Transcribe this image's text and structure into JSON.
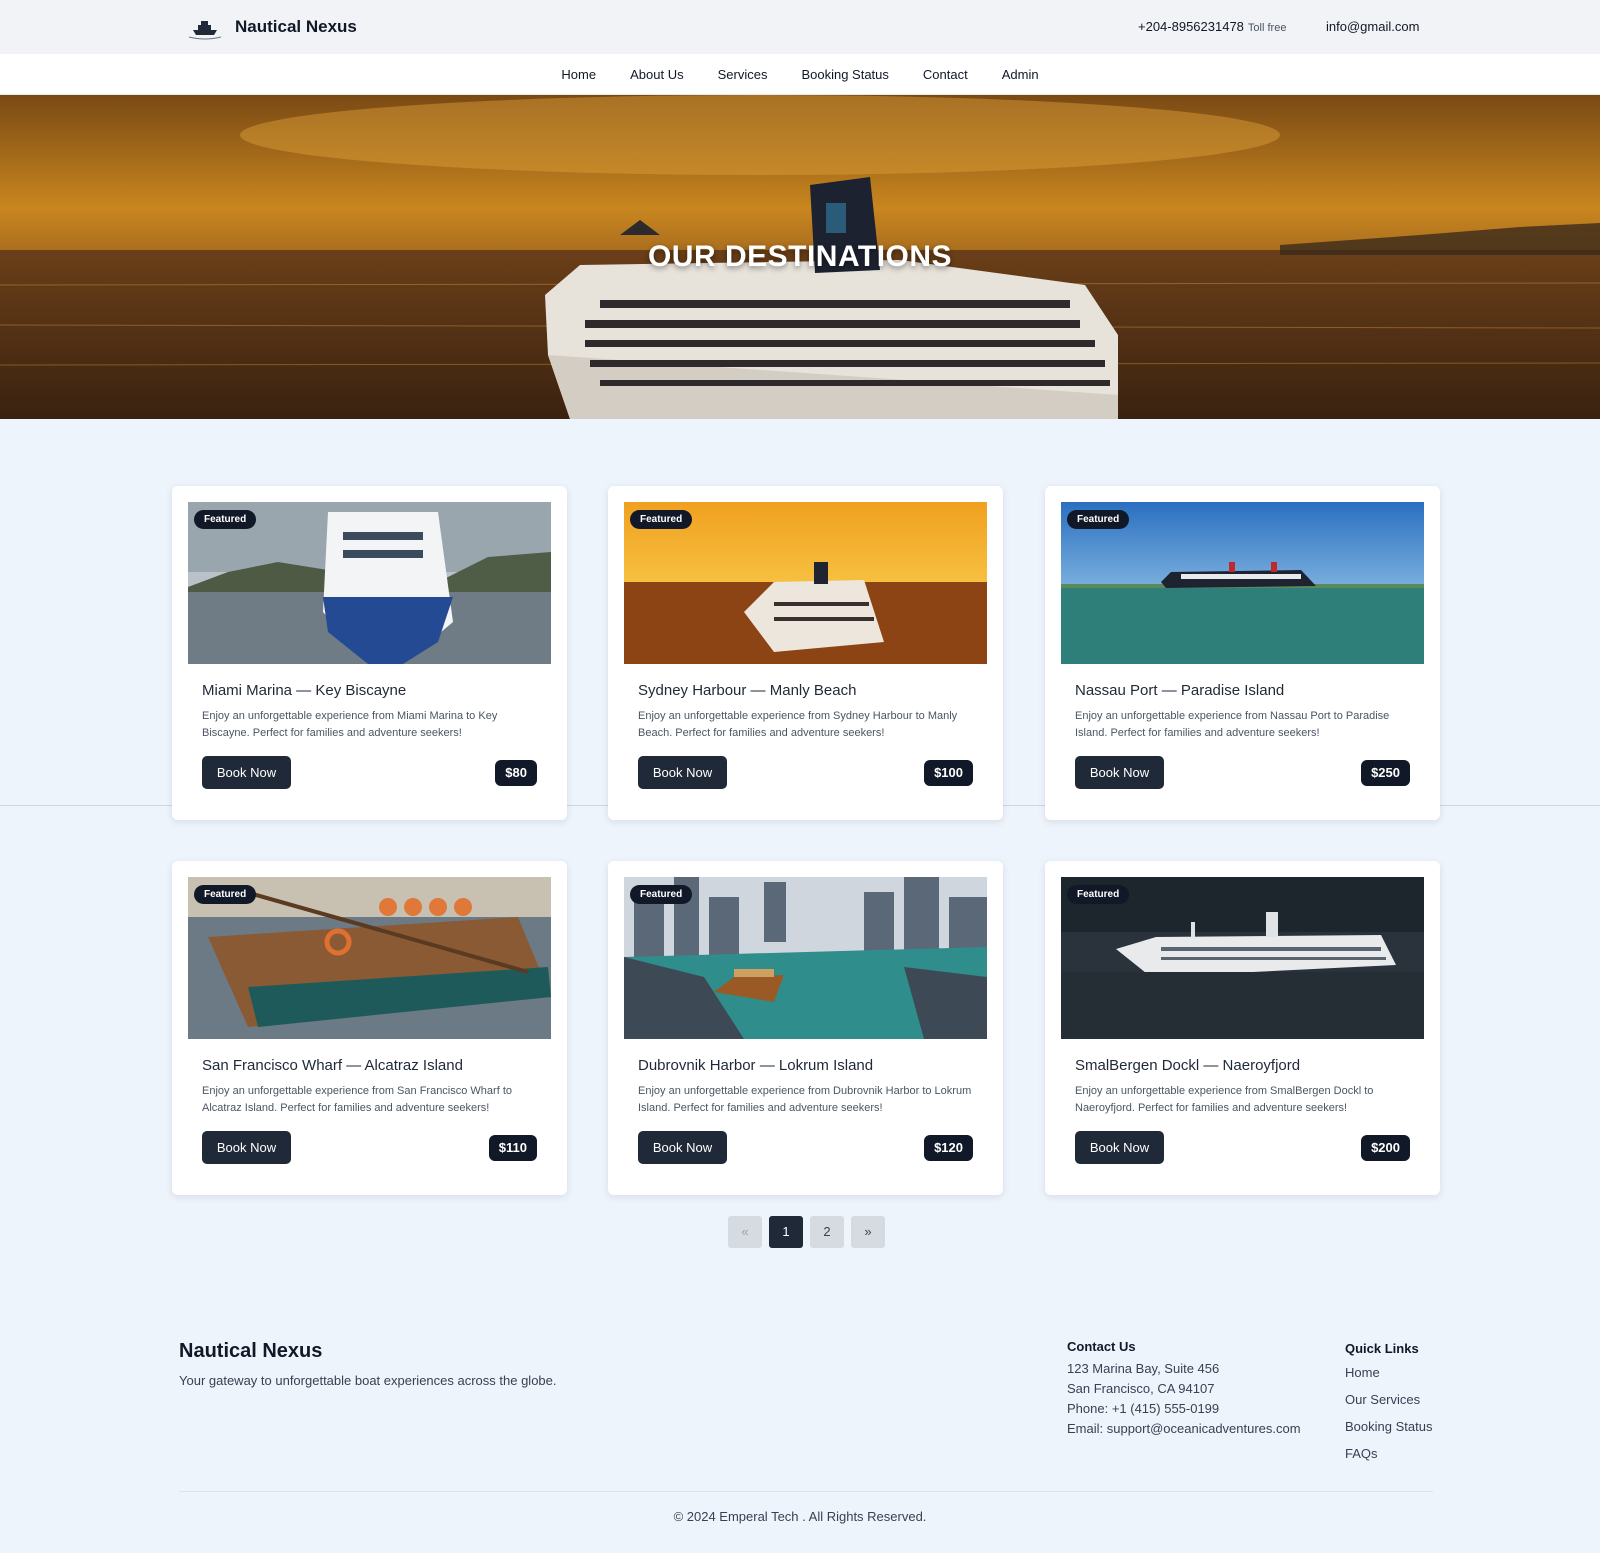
{
  "header": {
    "brand": "Nautical Nexus",
    "phone": "+204-8956231478",
    "phone_note": "Toll free",
    "email": "info@gmail.com"
  },
  "nav": {
    "items": [
      "Home",
      "About Us",
      "Services",
      "Booking Status",
      "Contact",
      "Admin"
    ]
  },
  "hero": {
    "title": "OUR DESTINATIONS"
  },
  "cards": [
    {
      "badge": "Featured",
      "title": "Miami Marina — Key Biscayne",
      "description": "Enjoy an unforgettable experience from Miami Marina to Key Biscayne. Perfect for families and adventure seekers!",
      "button": "Book Now",
      "price": "$80"
    },
    {
      "badge": "Featured",
      "title": "Sydney Harbour — Manly Beach",
      "description": "Enjoy an unforgettable experience from Sydney Harbour to Manly Beach. Perfect for families and adventure seekers!",
      "button": "Book Now",
      "price": "$100"
    },
    {
      "badge": "Featured",
      "title": "Nassau Port — Paradise Island",
      "description": "Enjoy an unforgettable experience from Nassau Port to Paradise Island. Perfect for families and adventure seekers!",
      "button": "Book Now",
      "price": "$250"
    },
    {
      "badge": "Featured",
      "title": "San Francisco Wharf — Alcatraz Island",
      "description": "Enjoy an unforgettable experience from San Francisco Wharf to Alcatraz Island. Perfect for families and adventure seekers!",
      "button": "Book Now",
      "price": "$110"
    },
    {
      "badge": "Featured",
      "title": "Dubrovnik Harbor — Lokrum Island",
      "description": "Enjoy an unforgettable experience from Dubrovnik Harbor to Lokrum Island. Perfect for families and adventure seekers!",
      "button": "Book Now",
      "price": "$120"
    },
    {
      "badge": "Featured",
      "title": "SmalBergen Dockl — Naeroyfjord",
      "description": "Enjoy an unforgettable experience from SmalBergen Dockl to Naeroyfjord. Perfect for families and adventure seekers!",
      "button": "Book Now",
      "price": "$200"
    }
  ],
  "pagination": {
    "prev": "«",
    "pages": [
      "1",
      "2"
    ],
    "current": "1",
    "next": "»"
  },
  "footer": {
    "brand": "Nautical Nexus",
    "tagline": "Your gateway to unforgettable boat experiences across the globe.",
    "contact_heading": "Contact Us",
    "contact_lines": [
      "123 Marina Bay, Suite 456",
      "San Francisco, CA 94107",
      "Phone: +1 (415) 555-0199",
      "Email: support@oceanicadventures.com"
    ],
    "links_heading": "Quick Links",
    "links": [
      "Home",
      "Our Services",
      "Booking Status",
      "FAQs"
    ],
    "copyright": "© 2024 Emperal Tech . All Rights Reserved."
  },
  "colors": {
    "page_bg": "#eef4fc",
    "dark": "#1f2937",
    "badge": "#111827"
  }
}
